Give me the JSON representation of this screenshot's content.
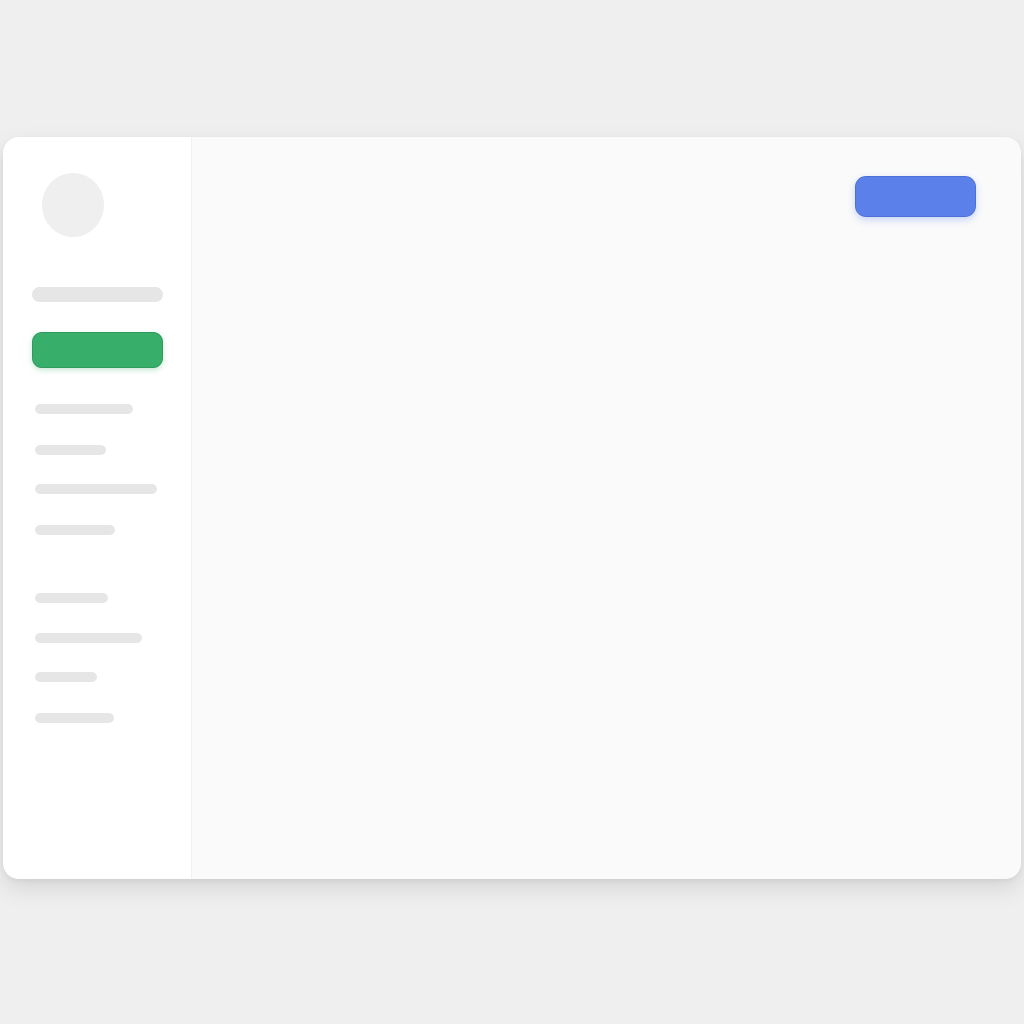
{
  "sidebar": {
    "avatar": {
      "icon": "user-avatar-placeholder"
    },
    "header_placeholder": {
      "label": ""
    },
    "primary_button": {
      "label": "",
      "color": "#38ae6b"
    },
    "items": [
      {
        "label": ""
      },
      {
        "label": ""
      },
      {
        "label": ""
      },
      {
        "label": ""
      },
      {
        "label": ""
      },
      {
        "label": ""
      },
      {
        "label": ""
      },
      {
        "label": ""
      }
    ]
  },
  "header": {
    "action_button": {
      "label": "",
      "color": "#5b80ea"
    }
  },
  "main": {
    "content": ""
  },
  "theme": {
    "background": "#efefef",
    "surface": "#fafafa",
    "sidebar": "#ffffff",
    "skeleton": "#e6e6e6"
  }
}
